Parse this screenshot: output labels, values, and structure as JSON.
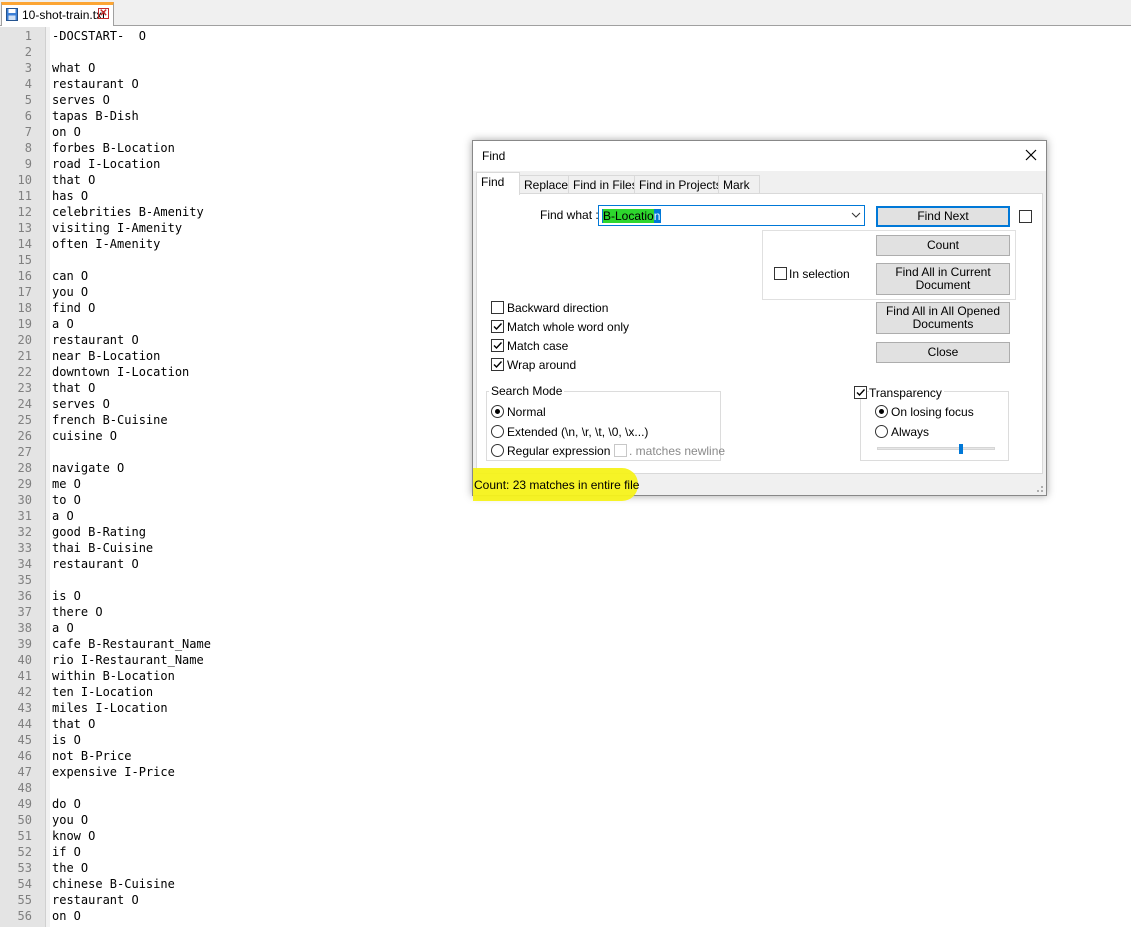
{
  "tab": {
    "filename": "10-shot-train.txt"
  },
  "editor": {
    "lines": [
      {
        "n": "1",
        "t": "-DOCSTART-  O"
      },
      {
        "n": "2",
        "t": ""
      },
      {
        "n": "3",
        "t": "what O"
      },
      {
        "n": "4",
        "t": "restaurant O"
      },
      {
        "n": "5",
        "t": "serves O"
      },
      {
        "n": "6",
        "t": "tapas B-Dish"
      },
      {
        "n": "7",
        "t": "on O"
      },
      {
        "n": "8",
        "t": "forbes B-Location"
      },
      {
        "n": "9",
        "t": "road I-Location"
      },
      {
        "n": "10",
        "t": "that O"
      },
      {
        "n": "11",
        "t": "has O"
      },
      {
        "n": "12",
        "t": "celebrities B-Amenity"
      },
      {
        "n": "13",
        "t": "visiting I-Amenity"
      },
      {
        "n": "14",
        "t": "often I-Amenity"
      },
      {
        "n": "15",
        "t": ""
      },
      {
        "n": "16",
        "t": "can O"
      },
      {
        "n": "17",
        "t": "you O"
      },
      {
        "n": "18",
        "t": "find O"
      },
      {
        "n": "19",
        "t": "a O"
      },
      {
        "n": "20",
        "t": "restaurant O"
      },
      {
        "n": "21",
        "t": "near B-Location"
      },
      {
        "n": "22",
        "t": "downtown I-Location"
      },
      {
        "n": "23",
        "t": "that O"
      },
      {
        "n": "24",
        "t": "serves O"
      },
      {
        "n": "25",
        "t": "french B-Cuisine"
      },
      {
        "n": "26",
        "t": "cuisine O"
      },
      {
        "n": "27",
        "t": ""
      },
      {
        "n": "28",
        "t": "navigate O"
      },
      {
        "n": "29",
        "t": "me O"
      },
      {
        "n": "30",
        "t": "to O"
      },
      {
        "n": "31",
        "t": "a O"
      },
      {
        "n": "32",
        "t": "good B-Rating"
      },
      {
        "n": "33",
        "t": "thai B-Cuisine"
      },
      {
        "n": "34",
        "t": "restaurant O"
      },
      {
        "n": "35",
        "t": ""
      },
      {
        "n": "36",
        "t": "is O"
      },
      {
        "n": "37",
        "t": "there O"
      },
      {
        "n": "38",
        "t": "a O"
      },
      {
        "n": "39",
        "t": "cafe B-Restaurant_Name"
      },
      {
        "n": "40",
        "t": "rio I-Restaurant_Name"
      },
      {
        "n": "41",
        "t": "within B-Location"
      },
      {
        "n": "42",
        "t": "ten I-Location"
      },
      {
        "n": "43",
        "t": "miles I-Location"
      },
      {
        "n": "44",
        "t": "that O"
      },
      {
        "n": "45",
        "t": "is O"
      },
      {
        "n": "46",
        "t": "not B-Price"
      },
      {
        "n": "47",
        "t": "expensive I-Price"
      },
      {
        "n": "48",
        "t": ""
      },
      {
        "n": "49",
        "t": "do O"
      },
      {
        "n": "50",
        "t": "you O"
      },
      {
        "n": "51",
        "t": "know O"
      },
      {
        "n": "52",
        "t": "if O"
      },
      {
        "n": "53",
        "t": "the O"
      },
      {
        "n": "54",
        "t": "chinese B-Cuisine"
      },
      {
        "n": "55",
        "t": "restaurant O"
      },
      {
        "n": "56",
        "t": "on O"
      }
    ]
  },
  "dialog": {
    "title": "Find",
    "tabs": [
      "Find",
      "Replace",
      "Find in Files",
      "Find in Projects",
      "Mark"
    ],
    "find_what_label": "Find what :",
    "find_value_hl": "B-Locatio",
    "find_value_rest": "n",
    "buttons": {
      "find_next": "Find Next",
      "count": "Count",
      "find_all_current_1": "Find All in Current",
      "find_all_current_2": "Document",
      "find_all_opened_1": "Find All in All Opened",
      "find_all_opened_2": "Documents",
      "close": "Close"
    },
    "in_selection": "In selection",
    "options": {
      "backward": "Backward direction",
      "whole_word": "Match whole word only",
      "match_case": "Match case",
      "wrap": "Wrap around"
    },
    "search_mode": {
      "title": "Search Mode",
      "normal": "Normal",
      "extended": "Extended (\\n, \\r, \\t, \\0, \\x...)",
      "regex": "Regular expression",
      "matches_newline": ". matches newline"
    },
    "transparency": {
      "title": "Transparency",
      "on_losing_focus": "On losing focus",
      "always": "Always",
      "level": 0.72
    },
    "status": "Count: 23 matches in entire file"
  }
}
